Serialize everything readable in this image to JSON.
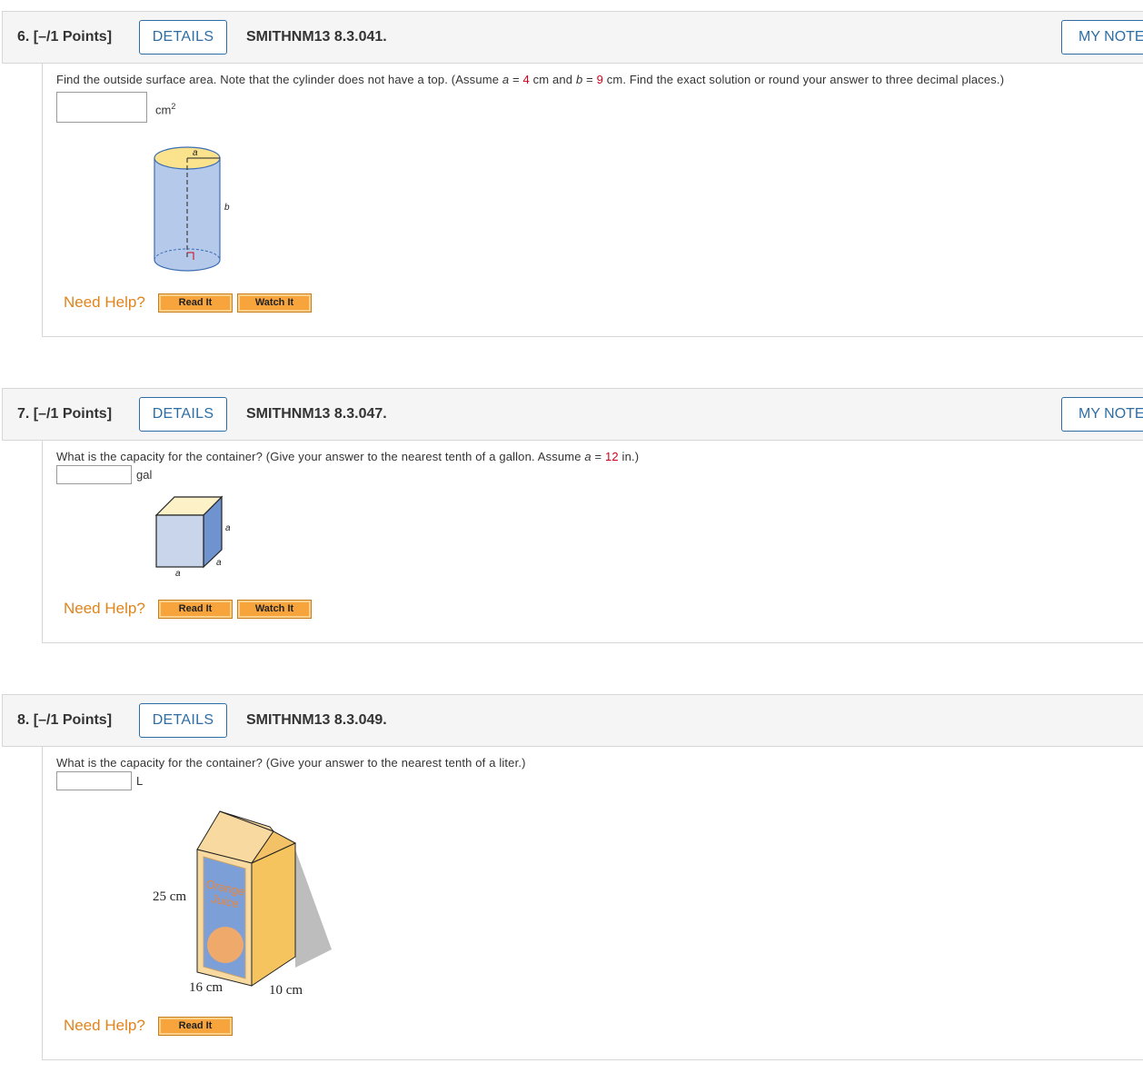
{
  "questions": [
    {
      "number": "6.",
      "points": "[–/1 Points]",
      "details_label": "DETAILS",
      "code": "SMITHNM13 8.3.041.",
      "notes_label": "MY NOTES",
      "prompt_parts": [
        "Find the outside surface area. Note that the cylinder does not have a top. (Assume ",
        "a",
        " = ",
        "4",
        " cm and ",
        "b",
        " = ",
        "9",
        " cm. Find the exact solution or round your answer to three decimal places.)"
      ],
      "answer_value": "",
      "unit": "cm",
      "unit_sup": "2",
      "figure_labels": {
        "a": "a",
        "b": "b"
      },
      "help_label": "Need Help?",
      "read_label": "Read It",
      "watch_label": "Watch It"
    },
    {
      "number": "7.",
      "points": "[–/1 Points]",
      "details_label": "DETAILS",
      "code": "SMITHNM13 8.3.047.",
      "notes_label": "MY NOTES",
      "prompt_parts": [
        "What is the capacity for the container? (Give your answer to the nearest tenth of a gallon. Assume ",
        "a",
        " = ",
        "12",
        " in.)"
      ],
      "answer_value": "",
      "unit": "gal",
      "figure_labels": {
        "a1": "a",
        "a2": "a",
        "a3": "a"
      },
      "help_label": "Need Help?",
      "read_label": "Read It",
      "watch_label": "Watch It"
    },
    {
      "number": "8.",
      "points": "[–/1 Points]",
      "details_label": "DETAILS",
      "code": "SMITHNM13 8.3.049.",
      "prompt_parts": [
        "What is the capacity for the container? (Give your answer to the nearest tenth of a liter.)"
      ],
      "answer_value": "",
      "unit": "L",
      "figure_labels": {
        "height": "25 cm",
        "width": "16 cm",
        "depth": "10 cm",
        "carton_line1": "Orange",
        "carton_line2": "Juice"
      },
      "help_label": "Need Help?",
      "read_label": "Read It"
    }
  ],
  "colors": {
    "accent_blue": "#2e6da4",
    "help_orange": "#e0841b",
    "value_red": "#d0021b",
    "button_orange": "#f6a43b"
  }
}
